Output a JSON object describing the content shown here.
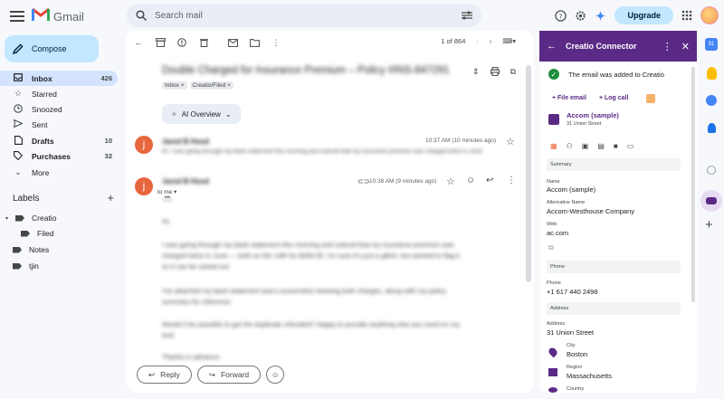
{
  "header": {
    "app_name": "Gmail",
    "search_placeholder": "Search mail",
    "upgrade_label": "Upgrade"
  },
  "sidebar": {
    "compose_label": "Compose",
    "items": [
      {
        "label": "Inbox",
        "count": "426",
        "icon": "inbox-icon",
        "bold": true,
        "active": true
      },
      {
        "label": "Starred",
        "count": "",
        "icon": "star-icon"
      },
      {
        "label": "Snoozed",
        "count": "",
        "icon": "clock-icon"
      },
      {
        "label": "Sent",
        "count": "",
        "icon": "send-icon"
      },
      {
        "label": "Drafts",
        "count": "10",
        "icon": "draft-icon",
        "bold": true
      },
      {
        "label": "Purchases",
        "count": "32",
        "icon": "tag-icon",
        "bold": true
      },
      {
        "label": "More",
        "count": "",
        "icon": "chevron-down-icon"
      }
    ],
    "labels_title": "Labels",
    "labels": [
      {
        "label": "Creatio"
      },
      {
        "label": "Filed"
      },
      {
        "label": "Notes"
      },
      {
        "label": "tjin"
      }
    ]
  },
  "email": {
    "pager": "1 of 864",
    "subject": "Double Charged for Insurance Premium – Policy #INS-847291",
    "chips": [
      "Inbox ×",
      "Creatio/Filed ×"
    ],
    "ai_overview_label": "AI Overview",
    "messages": [
      {
        "avatar_letter": "j",
        "sender": "Jared B Hood",
        "time": "10:37 AM (10 minutes ago)",
        "snippet": "Hi, I was going through my bank statement this morning and noticed that my insurance premium was charged twice in June"
      },
      {
        "avatar_letter": "j",
        "sender": "Jared B Hood",
        "time": "10:38 AM (9 minutes ago)",
        "to": "to me ▾",
        "body": [
          "Hi,",
          "I was going through my bank statement this morning and noticed that my insurance premium was",
          "charged twice in June — both on the 14th for $284.55. I'm sure it's just a glitch, but wanted to flag it",
          "so it can be sorted out.",
          "I've attached my bank statement and a screenshot showing both charges, along with my policy",
          "summary for reference.",
          "Would it be possible to get the duplicate refunded? Happy to provide anything else you need on my",
          "end.",
          "Thanks in advance,"
        ]
      }
    ],
    "reply_label": "Reply",
    "forward_label": "Forward"
  },
  "panel": {
    "title": "Creatio Connector",
    "success_message": "The email was added to Creatio",
    "add_file_label": "+ File email",
    "add_log_label": "+ Log call",
    "account_name": "Accom (sample)",
    "account_address": "31 Union Street",
    "sections": {
      "summary": "Summary",
      "phone": "Phone",
      "address": "Address"
    },
    "fields": {
      "name_label": "Name",
      "name_value": "Accom (sample)",
      "alt_name_label": "Alternative Name",
      "alt_name_value": "Accom-Westhouse Company",
      "web_label": "Web",
      "web_value": "ac.com",
      "phone_label": "Phone",
      "phone_value": "+1 617 440 2498",
      "address_label": "Address",
      "address_value": "31 Union Street",
      "city_label": "City",
      "city_value": "Boston",
      "region_label": "Region",
      "region_value": "Massachusetts",
      "country_label": "Country"
    }
  },
  "colors": {
    "accent": "#0b57d0",
    "panel_header": "#5b2a86",
    "avatar": "#e8663d",
    "success": "#1e8e3e"
  }
}
